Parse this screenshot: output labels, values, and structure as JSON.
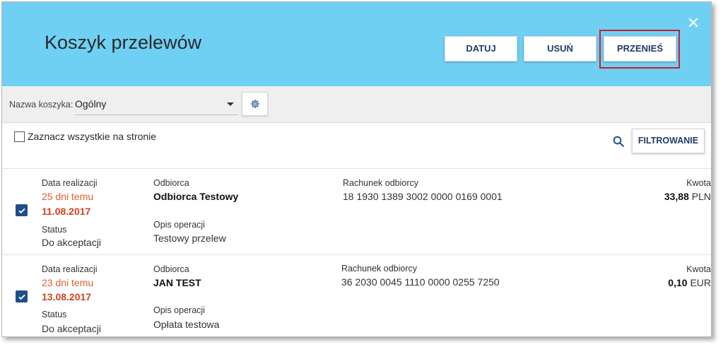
{
  "header": {
    "title": "Koszyk przelewów",
    "close_glyph": "✕",
    "buttons": {
      "datuj": "DATUJ",
      "usun": "USUŃ",
      "przenies": "PRZENIEŚ"
    }
  },
  "toolbar": {
    "basket_label": "Nazwa koszyka:",
    "basket_value": "Ogólny"
  },
  "list_controls": {
    "select_all_label": "Zaznacz wszystkie na stronie",
    "filter_label": "FILTROWANIE"
  },
  "labels": {
    "date": "Data realizacji",
    "status": "Status",
    "recipient": "Odbiorca",
    "description": "Opis operacji",
    "account": "Rachunek odbiorcy",
    "amount": "Kwota"
  },
  "rows": [
    {
      "checked": true,
      "relative_date": "25 dni temu",
      "date": "11.08.2017",
      "status": "Do akceptacji",
      "recipient": "Odbiorca Testowy",
      "description": "Testowy przelew",
      "account": "18 1930 1389 3002 0000 0169 0001",
      "amount": "33,88",
      "currency": "PLN"
    },
    {
      "checked": true,
      "relative_date": "23 dni temu",
      "date": "13.08.2017",
      "status": "Do akceptacji",
      "recipient": "JAN TEST",
      "description": "Opłata testowa",
      "account": "36 2030 0045 1110 0000 0255 7250",
      "amount": "0,10",
      "currency": "EUR"
    }
  ],
  "colors": {
    "header_bg": "#6fd0f3",
    "button_text": "#1f3c66",
    "highlight": "#cc1f2a",
    "date_red": "#d04420",
    "checkbox": "#1f4f8a"
  }
}
